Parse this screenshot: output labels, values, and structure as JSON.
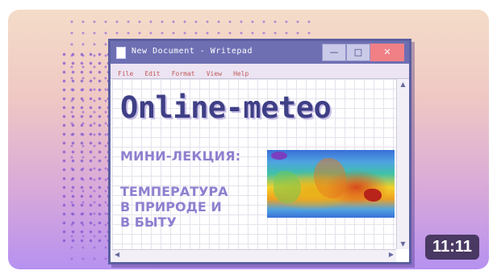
{
  "window": {
    "title": "New Document - Writepad",
    "buttons": {
      "minimize": "—",
      "maximize": "□",
      "close": "✕"
    },
    "menu": [
      "File",
      "Edit",
      "Format",
      "View",
      "Help"
    ]
  },
  "document": {
    "headline": "Online-meteo",
    "subtitle": "МИНИ-ЛЕКЦИЯ:",
    "lines": [
      "ТЕМПЕРАТУРА",
      "В ПРИРОДЕ И",
      "В БЫТУ"
    ]
  },
  "video": {
    "duration": "11:11"
  },
  "colors": {
    "title_bar": "#6e6fb3",
    "headline": "#3f3f86",
    "body_text": "#8f7fcf",
    "close_button": "#f07f86"
  }
}
